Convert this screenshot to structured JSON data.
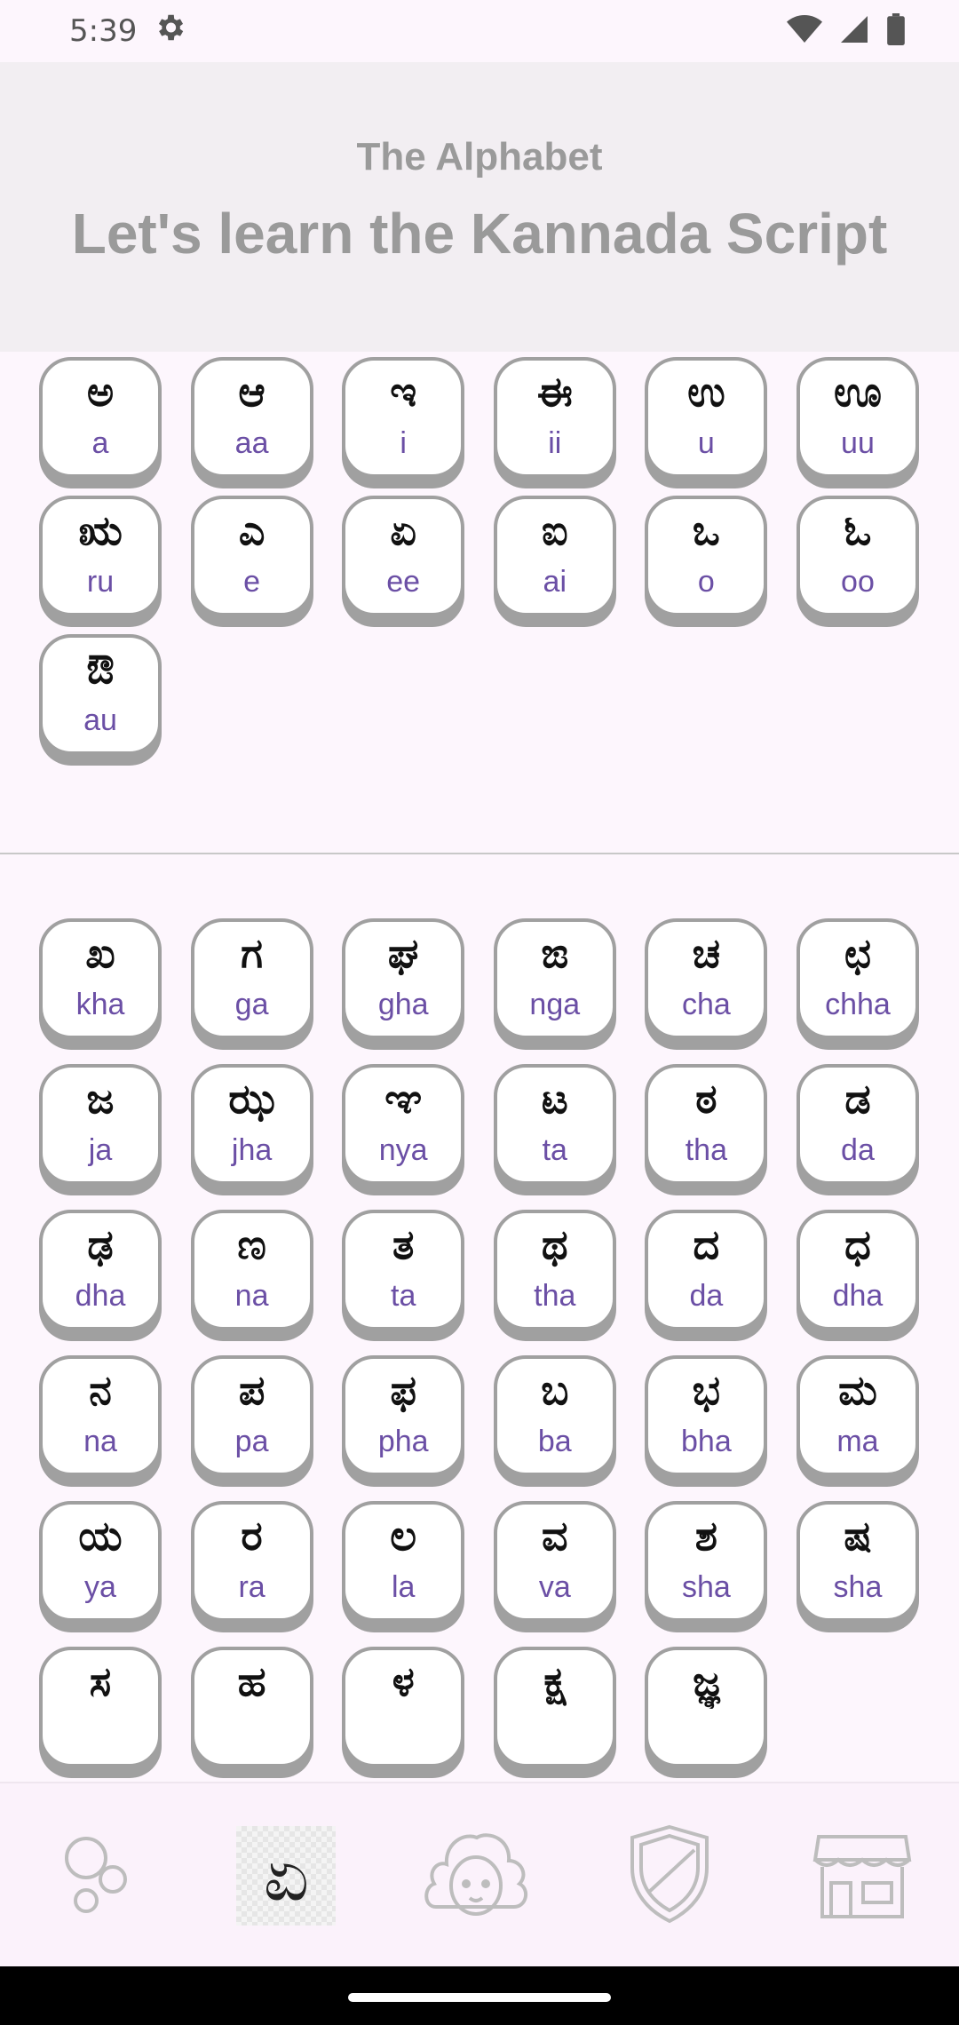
{
  "status": {
    "time": "5:39"
  },
  "header": {
    "subtitle": "The Alphabet",
    "title": "Let's learn the Kannada Script"
  },
  "vowels": [
    {
      "kn": "ಅ",
      "tr": "a"
    },
    {
      "kn": "ಆ",
      "tr": "aa"
    },
    {
      "kn": "ಇ",
      "tr": "i"
    },
    {
      "kn": "ಈ",
      "tr": "ii"
    },
    {
      "kn": "ಉ",
      "tr": "u"
    },
    {
      "kn": "ಊ",
      "tr": "uu"
    },
    {
      "kn": "ಋ",
      "tr": "ru"
    },
    {
      "kn": "ಎ",
      "tr": "e"
    },
    {
      "kn": "ಏ",
      "tr": "ee"
    },
    {
      "kn": "ಐ",
      "tr": "ai"
    },
    {
      "kn": "ಒ",
      "tr": "o"
    },
    {
      "kn": "ಓ",
      "tr": "oo"
    },
    {
      "kn": "ಔ",
      "tr": "au"
    }
  ],
  "consonants": [
    {
      "kn": "ಖ",
      "tr": "kha"
    },
    {
      "kn": "ಗ",
      "tr": "ga"
    },
    {
      "kn": "ಘ",
      "tr": "gha"
    },
    {
      "kn": "ಙ",
      "tr": "nga"
    },
    {
      "kn": "ಚ",
      "tr": "cha"
    },
    {
      "kn": "ಛ",
      "tr": "chha"
    },
    {
      "kn": "ಜ",
      "tr": "ja"
    },
    {
      "kn": "ಝ",
      "tr": "jha"
    },
    {
      "kn": "ಞ",
      "tr": "nya"
    },
    {
      "kn": "ಟ",
      "tr": "ta"
    },
    {
      "kn": "ಠ",
      "tr": "tha"
    },
    {
      "kn": "ಡ",
      "tr": "da"
    },
    {
      "kn": "ಢ",
      "tr": "dha"
    },
    {
      "kn": "ಣ",
      "tr": "na"
    },
    {
      "kn": "ತ",
      "tr": "ta"
    },
    {
      "kn": "ಥ",
      "tr": "tha"
    },
    {
      "kn": "ದ",
      "tr": "da"
    },
    {
      "kn": "ಧ",
      "tr": "dha"
    },
    {
      "kn": "ನ",
      "tr": "na"
    },
    {
      "kn": "ಪ",
      "tr": "pa"
    },
    {
      "kn": "ಫ",
      "tr": "pha"
    },
    {
      "kn": "ಬ",
      "tr": "ba"
    },
    {
      "kn": "ಭ",
      "tr": "bha"
    },
    {
      "kn": "ಮ",
      "tr": "ma"
    },
    {
      "kn": "ಯ",
      "tr": "ya"
    },
    {
      "kn": "ರ",
      "tr": "ra"
    },
    {
      "kn": "ಲ",
      "tr": "la"
    },
    {
      "kn": "ವ",
      "tr": "va"
    },
    {
      "kn": "ಶ",
      "tr": "sha"
    },
    {
      "kn": "ಷ",
      "tr": "sha"
    },
    {
      "kn": "ಸ",
      "tr": ""
    },
    {
      "kn": "ಹ",
      "tr": ""
    },
    {
      "kn": "ಳ",
      "tr": ""
    },
    {
      "kn": "ಕ್ಷ",
      "tr": ""
    },
    {
      "kn": "ಜ್ಞ",
      "tr": ""
    }
  ],
  "nav": {
    "active_glyph": "ಏ",
    "items": [
      "bubbles-icon",
      "alphabet-icon",
      "avatar-icon",
      "shield-icon",
      "store-icon"
    ]
  }
}
